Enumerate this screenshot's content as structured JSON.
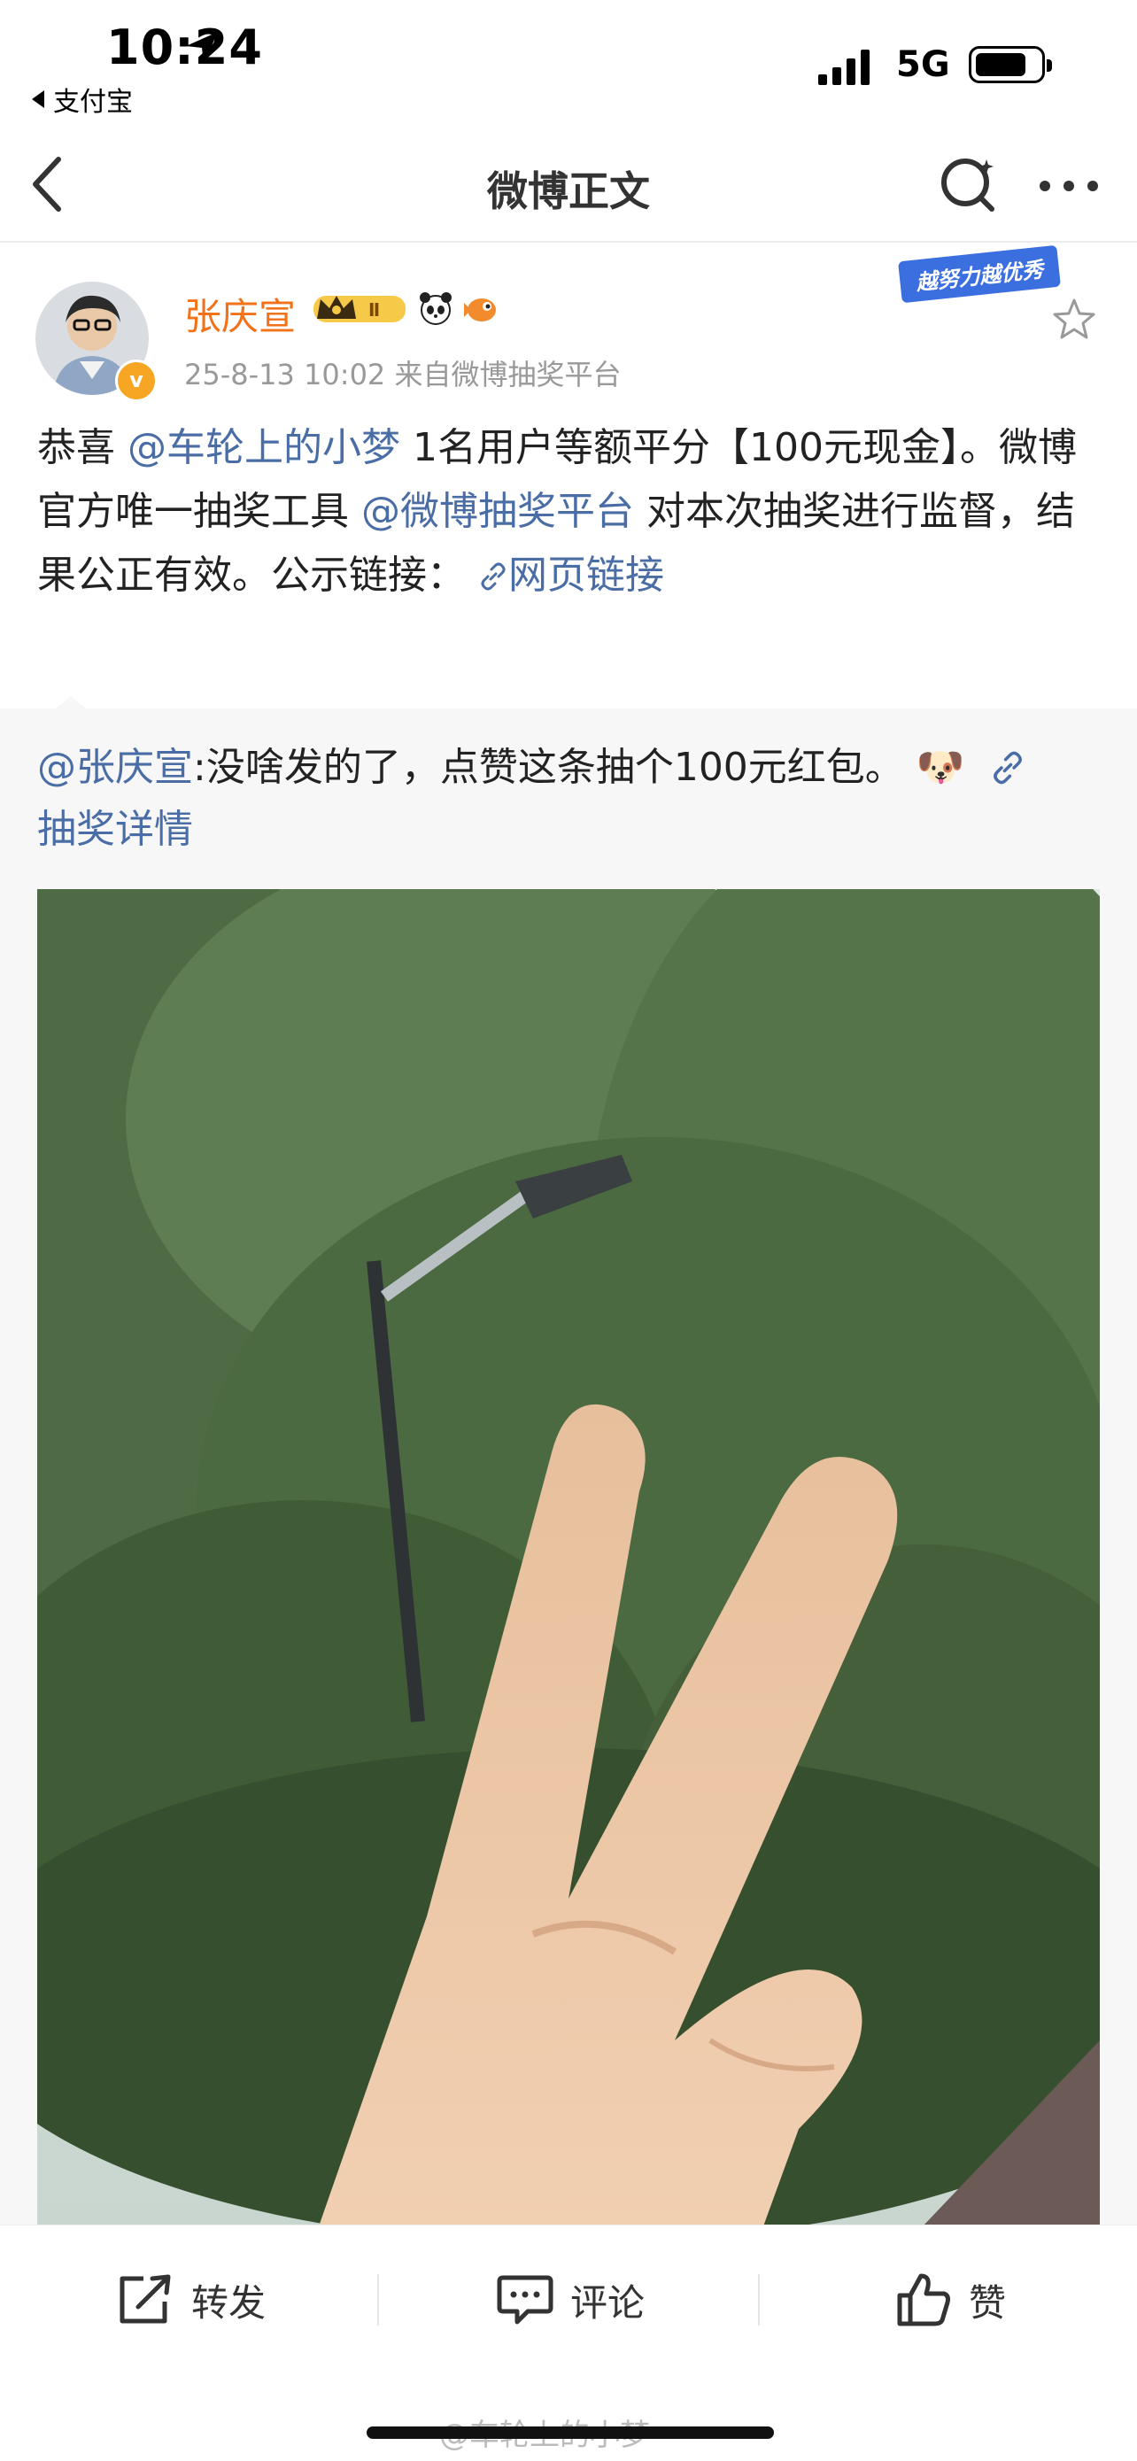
{
  "status_bar": {
    "time": "10:24",
    "back_app": "支付宝",
    "network": "5G",
    "battery_percent": 75
  },
  "nav": {
    "title": "微博正文",
    "back_icon": "chevron-left-icon",
    "search_icon": "search-icon",
    "more_icon": "more-dots-icon"
  },
  "post": {
    "username": "张庆宣",
    "level_badge": "Ⅱ",
    "promo_tag": "越努力越优秀",
    "meta": "25-8-13 10:02  来自微博抽奖平台",
    "text_parts": {
      "p1": "恭喜",
      "mention1": "@车轮上的小梦",
      "p2": " 1名用户等额平分【100元现金】。微博官方唯一抽奖工具",
      "mention2": "@微博抽奖平台",
      "p3": " 对本次抽奖进行监督，结果公正有效。公示链接：",
      "link": "网页链接"
    }
  },
  "retweet": {
    "mention": "@张庆宣",
    "text": ":没啥发的了，点赞这条抽个100元红包。",
    "emoji": "🐶",
    "link": "抽奖详情"
  },
  "actions": {
    "repost": "转发",
    "comment": "评论",
    "like": "赞"
  },
  "watermark": "@车轮上的小梦",
  "colors": {
    "username": "#f2721a",
    "link": "#4a6da6",
    "meta": "#999999"
  }
}
